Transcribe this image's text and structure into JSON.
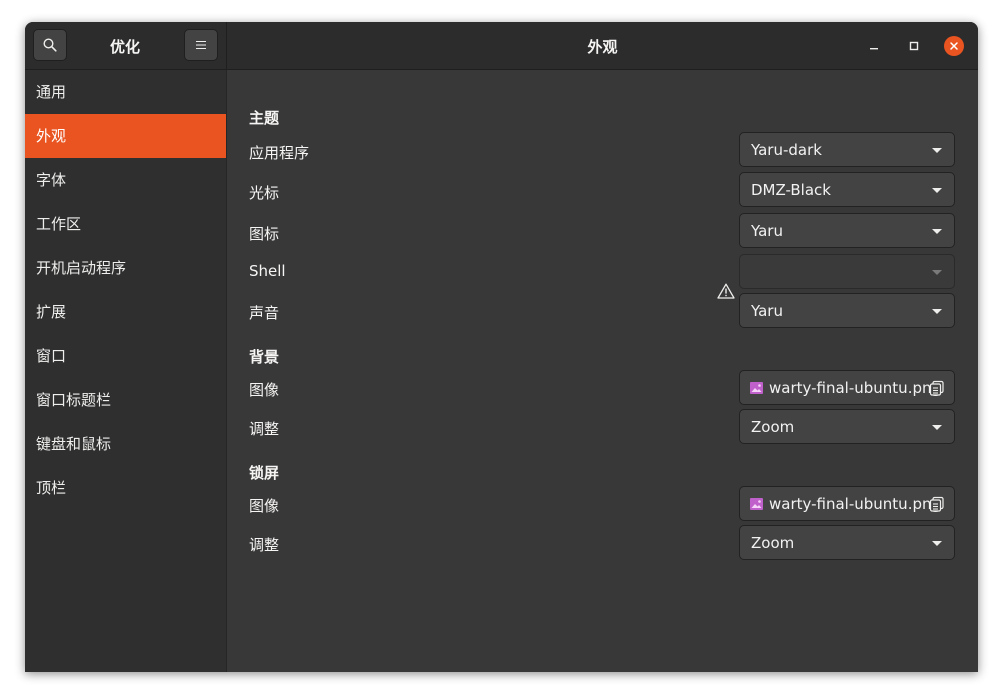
{
  "app": {
    "title": "优化",
    "window_title": "外观",
    "accent": "#e95420"
  },
  "header": {
    "search_icon": "search-icon",
    "menu_icon": "hamburger-menu-icon",
    "minimize_icon": "minimize-icon",
    "maximize_icon": "maximize-icon",
    "close_icon": "close-icon"
  },
  "sidebar": {
    "items": [
      {
        "label": "通用",
        "active": false
      },
      {
        "label": "外观",
        "active": true
      },
      {
        "label": "字体",
        "active": false
      },
      {
        "label": "工作区",
        "active": false
      },
      {
        "label": "开机启动程序",
        "active": false
      },
      {
        "label": "扩展",
        "active": false
      },
      {
        "label": "窗口",
        "active": false
      },
      {
        "label": "窗口标题栏",
        "active": false
      },
      {
        "label": "键盘和鼠标",
        "active": false
      },
      {
        "label": "顶栏",
        "active": false
      }
    ]
  },
  "theme": {
    "heading": "主题",
    "applications": {
      "label": "应用程序",
      "value": "Yaru-dark"
    },
    "cursor": {
      "label": "光标",
      "value": "DMZ-Black"
    },
    "icons": {
      "label": "图标",
      "value": "Yaru"
    },
    "shell": {
      "label": "Shell",
      "value": "",
      "warning_icon": "warning-icon",
      "disabled": true
    },
    "sound": {
      "label": "声音",
      "value": "Yaru"
    }
  },
  "background": {
    "heading": "背景",
    "image": {
      "label": "图像",
      "value": "warty-final-ubuntu.png"
    },
    "adjustment": {
      "label": "调整",
      "value": "Zoom"
    }
  },
  "lockscreen": {
    "heading": "锁屏",
    "image": {
      "label": "图像",
      "value": "warty-final-ubuntu.png"
    },
    "adjustment": {
      "label": "调整",
      "value": "Zoom"
    }
  }
}
